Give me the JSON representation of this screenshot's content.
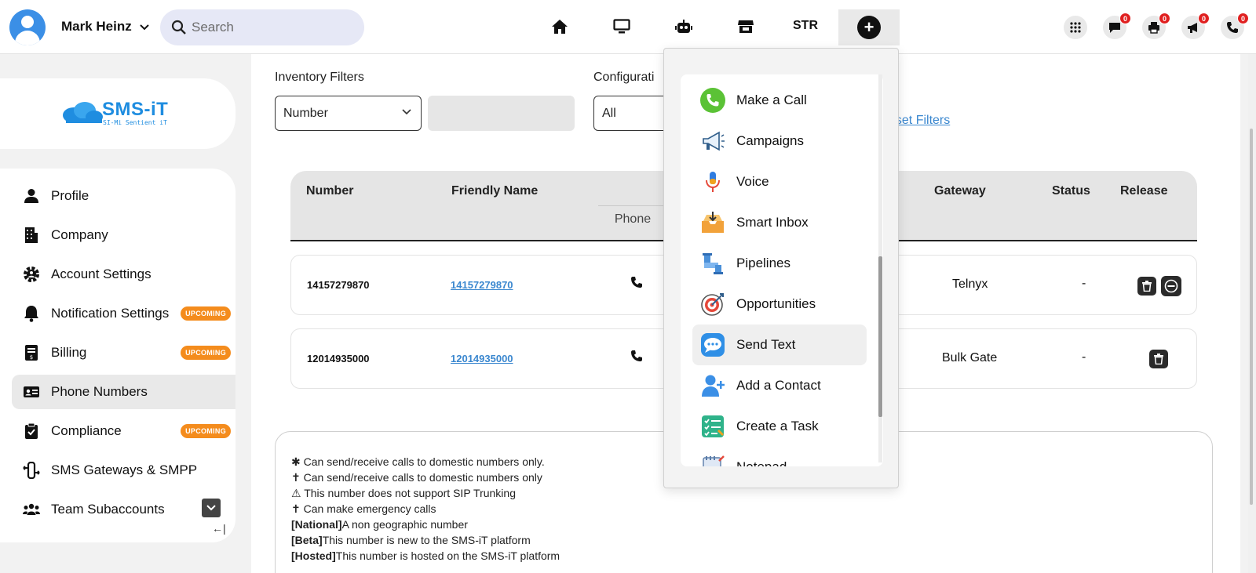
{
  "header": {
    "username": "Mark Heinz",
    "search_placeholder": "Search",
    "nav": [
      "home-icon",
      "monitor-icon",
      "robot-icon",
      "store-icon"
    ],
    "str_label": "STR",
    "add_icon": "+",
    "notifications": [
      {
        "icon": "apps-grid-icon",
        "count": null
      },
      {
        "icon": "chat-icon",
        "count": "0"
      },
      {
        "icon": "printer-icon",
        "count": "0"
      },
      {
        "icon": "megaphone-icon",
        "count": "0"
      },
      {
        "icon": "phone-icon",
        "count": "0"
      }
    ]
  },
  "logo": {
    "text": "SMS-iT",
    "tagline": "SI-Mi Sentient iT"
  },
  "sidebar": {
    "items": [
      {
        "label": "Profile",
        "icon": "user-icon",
        "badge": null
      },
      {
        "label": "Company",
        "icon": "building-icon",
        "badge": null
      },
      {
        "label": "Account Settings",
        "icon": "gear-user-icon",
        "badge": null
      },
      {
        "label": "Notification Settings",
        "icon": "bell-icon",
        "badge": "UPCOMING"
      },
      {
        "label": "Billing",
        "icon": "invoice-icon",
        "badge": "UPCOMING"
      },
      {
        "label": "Phone Numbers",
        "icon": "id-card-icon",
        "badge": null,
        "active": true
      },
      {
        "label": "Compliance",
        "icon": "clipboard-check-icon",
        "badge": "UPCOMING"
      },
      {
        "label": "SMS Gateways & SMPP",
        "icon": "gateway-icon",
        "badge": null
      },
      {
        "label": "Team Subaccounts",
        "icon": "team-icon",
        "badge": null
      }
    ],
    "collapse_arrow": "←|"
  },
  "filters": {
    "inventory_label": "Inventory Filters",
    "inventory_value": "Number",
    "configuration_label": "Configurati",
    "configuration_value": "All",
    "reset_label": "eset Filters"
  },
  "table": {
    "headers": {
      "number": "Number",
      "friendly_name": "Friendly Name",
      "phone": "Phone",
      "gateway": "Gateway",
      "status": "Status",
      "release": "Release"
    },
    "rows": [
      {
        "number": "14157279870",
        "friendly_name": "14157279870",
        "gateway": "Telnyx",
        "status": "-"
      },
      {
        "number": "12014935000",
        "friendly_name": "12014935000",
        "gateway": "Bulk Gate",
        "status": "-"
      }
    ]
  },
  "legend": [
    {
      "symbol": "✱",
      "bold": "",
      "text": "Can send/receive calls to domestic numbers only."
    },
    {
      "symbol": "✝",
      "bold": "",
      "text": "Can send/receive calls to domestic numbers only"
    },
    {
      "symbol": "⚠",
      "bold": "",
      "text": "This number does not support SIP Trunking"
    },
    {
      "symbol": "✝",
      "bold": "",
      "text": "Can make emergency calls"
    },
    {
      "symbol": "",
      "bold": "[National]",
      "text": "A non geographic number"
    },
    {
      "symbol": "",
      "bold": "[Beta]",
      "text": "This number is new to the SMS-iT platform"
    },
    {
      "symbol": "",
      "bold": "[Hosted]",
      "text": "This number is hosted on the SMS-iT platform"
    }
  ],
  "dropdown": {
    "items": [
      {
        "label": "Make a Call",
        "icon": "phone-call-icon"
      },
      {
        "label": "Campaigns",
        "icon": "megaphone-icon"
      },
      {
        "label": "Voice",
        "icon": "microphone-icon"
      },
      {
        "label": "Smart Inbox",
        "icon": "inbox-icon"
      },
      {
        "label": "Pipelines",
        "icon": "pipeline-icon"
      },
      {
        "label": "Opportunities",
        "icon": "target-icon"
      },
      {
        "label": "Send Text",
        "icon": "chat-bubble-icon",
        "hover": true
      },
      {
        "label": "Add a Contact",
        "icon": "add-user-icon"
      },
      {
        "label": "Create a Task",
        "icon": "task-list-icon"
      },
      {
        "label": "Notepad",
        "icon": "notepad-icon"
      }
    ]
  },
  "colors": {
    "accent": "#1f8de0",
    "upcoming": "#f48c1d",
    "badge": "#e02020",
    "link": "#3a87cf"
  }
}
